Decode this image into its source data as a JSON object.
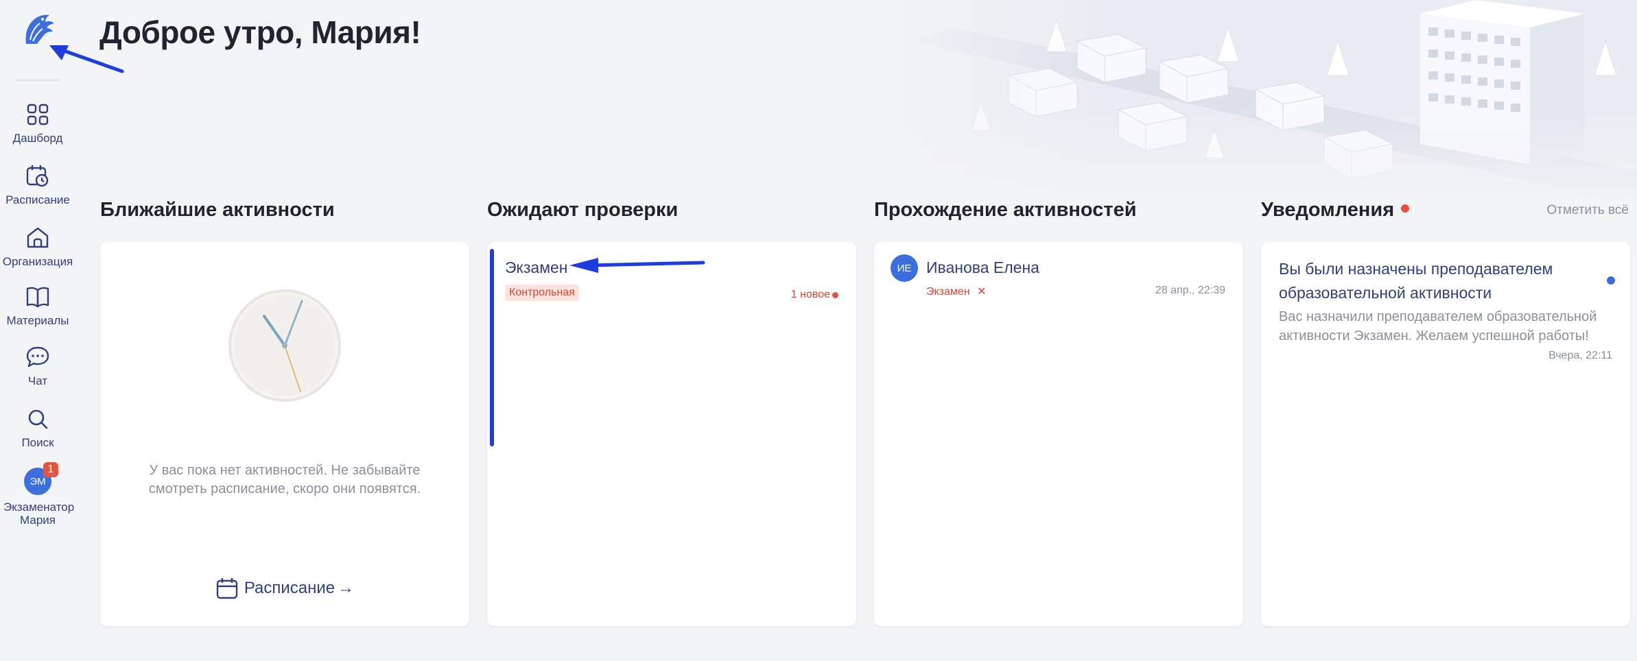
{
  "header": {
    "greeting": "Доброе утро, Мария!"
  },
  "sidebar": {
    "items": [
      {
        "label": "Дашборд",
        "icon": "dashboard-icon"
      },
      {
        "label": "Расписание",
        "icon": "calendar-clock-icon"
      },
      {
        "label": "Организация",
        "icon": "home-icon"
      },
      {
        "label": "Материалы",
        "icon": "book-icon"
      },
      {
        "label": "Чат",
        "icon": "chat-icon"
      },
      {
        "label": "Поиск",
        "icon": "search-icon"
      }
    ],
    "profile": {
      "initials": "ЭМ",
      "name": "Экзаменатор Мария",
      "badge_count": "1"
    }
  },
  "sections": {
    "upcoming": {
      "title": "Ближайшие активности",
      "empty_text": "У вас пока нет активностей. Не забывайте смотреть расписание, скоро они появятся.",
      "link_label": "Расписание",
      "link_arrow": "→"
    },
    "review": {
      "title": "Ожидают проверки",
      "items": [
        {
          "title": "Экзамен",
          "tag": "Контрольная",
          "new_label": "1 новое"
        }
      ]
    },
    "progress": {
      "title": "Прохождение активностей",
      "items": [
        {
          "initials": "ИЕ",
          "name": "Иванова Елена",
          "activity": "Экзамен",
          "status_icon": "✕",
          "time": "28 апр., 22:39"
        }
      ]
    },
    "notifications": {
      "title": "Уведомления",
      "mark_all": "Отметить всё",
      "items": [
        {
          "title": "Вы были назначены преподавателем образовательной активности",
          "body": "Вас назначили преподавателем образовательной активности Экзамен. Желаем успешной работы!",
          "time": "Вчера, 22:11"
        }
      ]
    }
  },
  "colors": {
    "accent": "#2f3f80",
    "brand_blue": "#3b6fe0",
    "alert_red": "#e5533d",
    "annotation_blue": "#1d3de0",
    "background": "#f3f4f6"
  }
}
